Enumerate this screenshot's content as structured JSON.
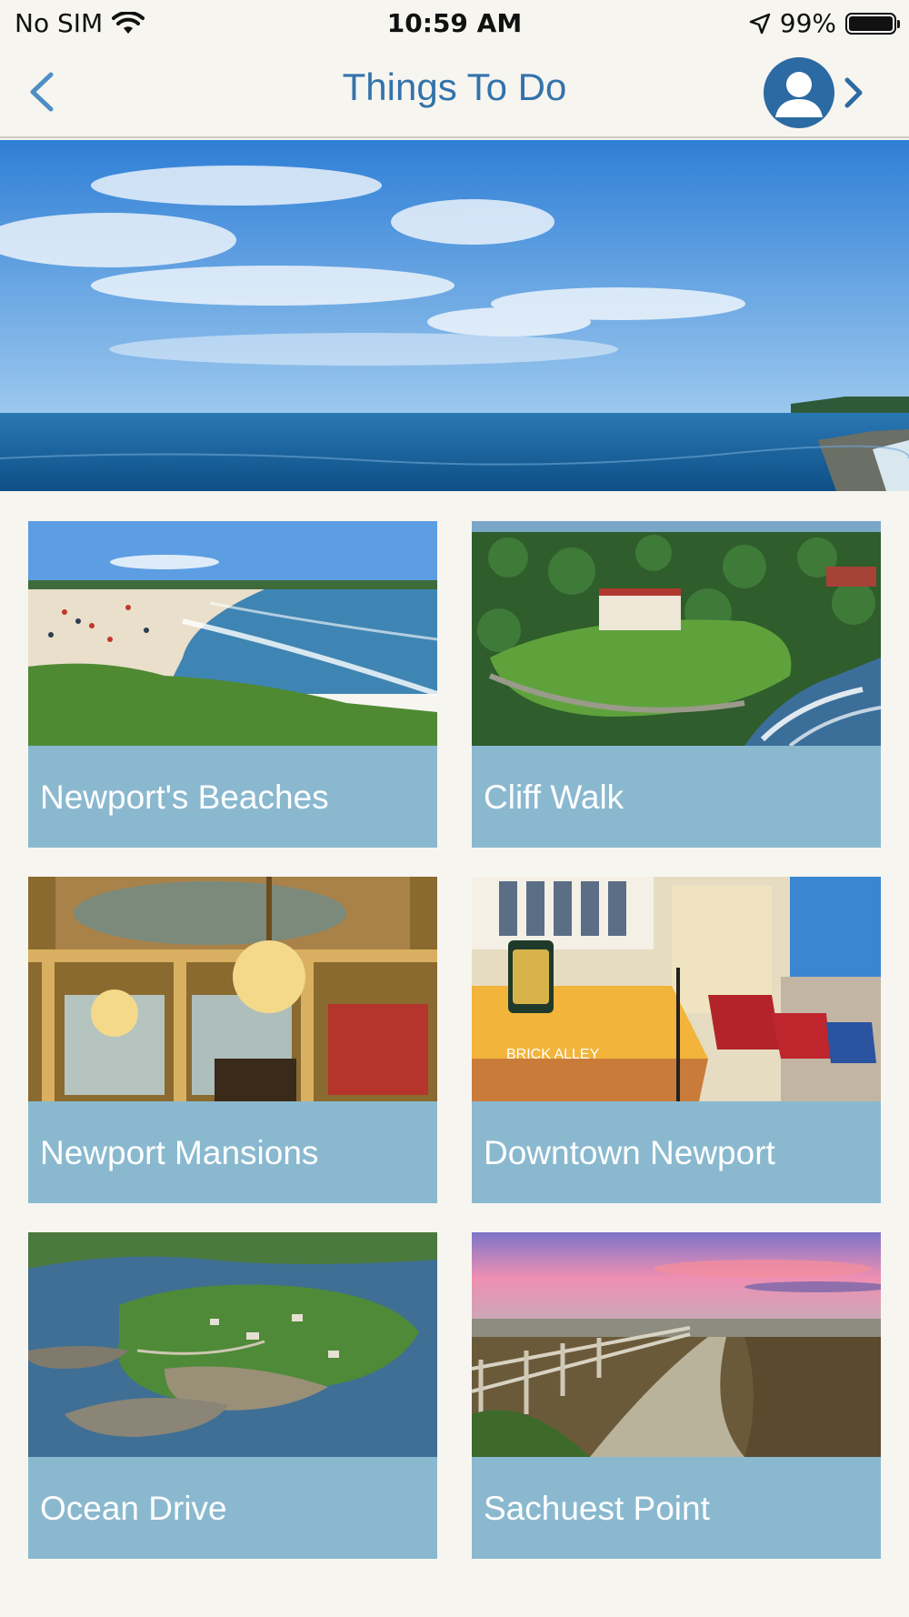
{
  "status_bar": {
    "carrier": "No SIM",
    "time": "10:59 AM",
    "battery": "99%",
    "battery_level": 0.99
  },
  "nav": {
    "title": "Things To Do",
    "back_icon": "chevron-left-icon",
    "profile_icon": "user-avatar-icon",
    "forward_icon": "chevron-right-icon"
  },
  "colors": {
    "accent": "#3373ab",
    "tile_label_bg": "#8ab9cf",
    "background": "#f7f5f0"
  },
  "tiles": [
    {
      "label": "Newport's Beaches"
    },
    {
      "label": "Cliff Walk"
    },
    {
      "label": "Newport Mansions"
    },
    {
      "label": "Downtown Newport"
    },
    {
      "label": "Ocean Drive"
    },
    {
      "label": "Sachuest Point"
    }
  ],
  "storefront_sign": "BRICK ALLEY"
}
